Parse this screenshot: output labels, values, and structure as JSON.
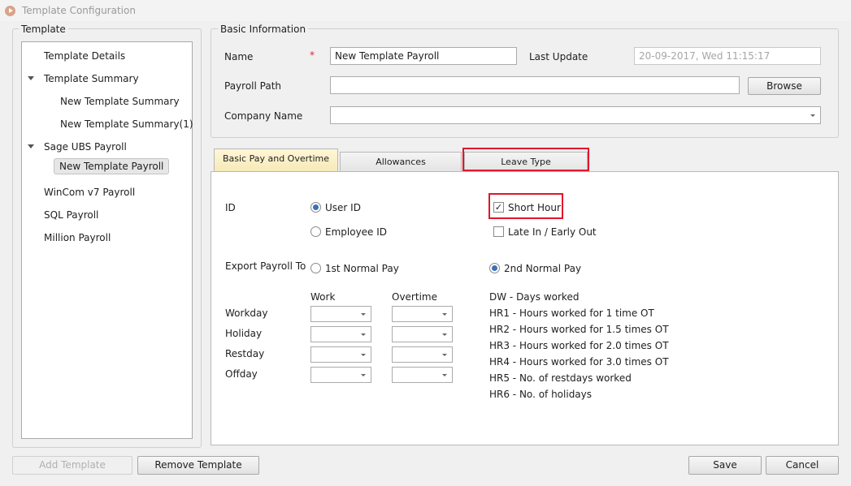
{
  "window": {
    "title": "Template Configuration"
  },
  "template_group": {
    "legend": "Template",
    "tree": [
      {
        "label": "Template Details"
      },
      {
        "label": "Template Summary"
      },
      {
        "label": "New Template Summary"
      },
      {
        "label": "New Template Summary(1)"
      },
      {
        "label": "Sage UBS Payroll"
      },
      {
        "label": "New Template Payroll"
      },
      {
        "label": "WinCom v7 Payroll"
      },
      {
        "label": "SQL Payroll"
      },
      {
        "label": "Million Payroll"
      }
    ]
  },
  "basic_info": {
    "legend": "Basic Information",
    "name_label": "Name",
    "required_mark": "*",
    "name_value": "New Template Payroll",
    "last_update_label": "Last Update",
    "last_update_value": "20-09-2017, Wed  11:15:17",
    "payroll_path_label": "Payroll Path",
    "payroll_path_value": "",
    "browse_button": "Browse",
    "company_name_label": "Company Name",
    "company_name_value": ""
  },
  "tabs": [
    {
      "label": "Basic Pay and Overtime",
      "active": true
    },
    {
      "label": "Allowances",
      "active": false
    },
    {
      "label": "Leave Type",
      "active": false
    }
  ],
  "panel": {
    "id_label": "ID",
    "user_id": "User ID",
    "employee_id": "Employee ID",
    "short_hour": "Short Hour",
    "late_in_early_out": "Late In / Early Out",
    "export_label": "Export Payroll To",
    "first_normal_pay": "1st Normal Pay",
    "second_normal_pay": "2nd Normal Pay",
    "work_header": "Work",
    "overtime_header": "Overtime",
    "rows": [
      "Workday",
      "Holiday",
      "Restday",
      "Offday"
    ],
    "legend_lines": [
      "DW - Days worked",
      "HR1 - Hours worked for 1 time OT",
      "HR2 - Hours worked for 1.5 times OT",
      "HR3 - Hours worked for 2.0 times OT",
      "HR4 - Hours worked for 3.0 times OT",
      "HR5 - No. of restdays worked",
      "HR6 - No. of holidays"
    ]
  },
  "footer": {
    "add_template": "Add Template",
    "remove_template": "Remove Template",
    "save": "Save",
    "cancel": "Cancel"
  },
  "colors": {
    "highlight": "#e0162b",
    "radio_selected": "#3c6fb7",
    "active_tab": "#f6e9b9"
  }
}
